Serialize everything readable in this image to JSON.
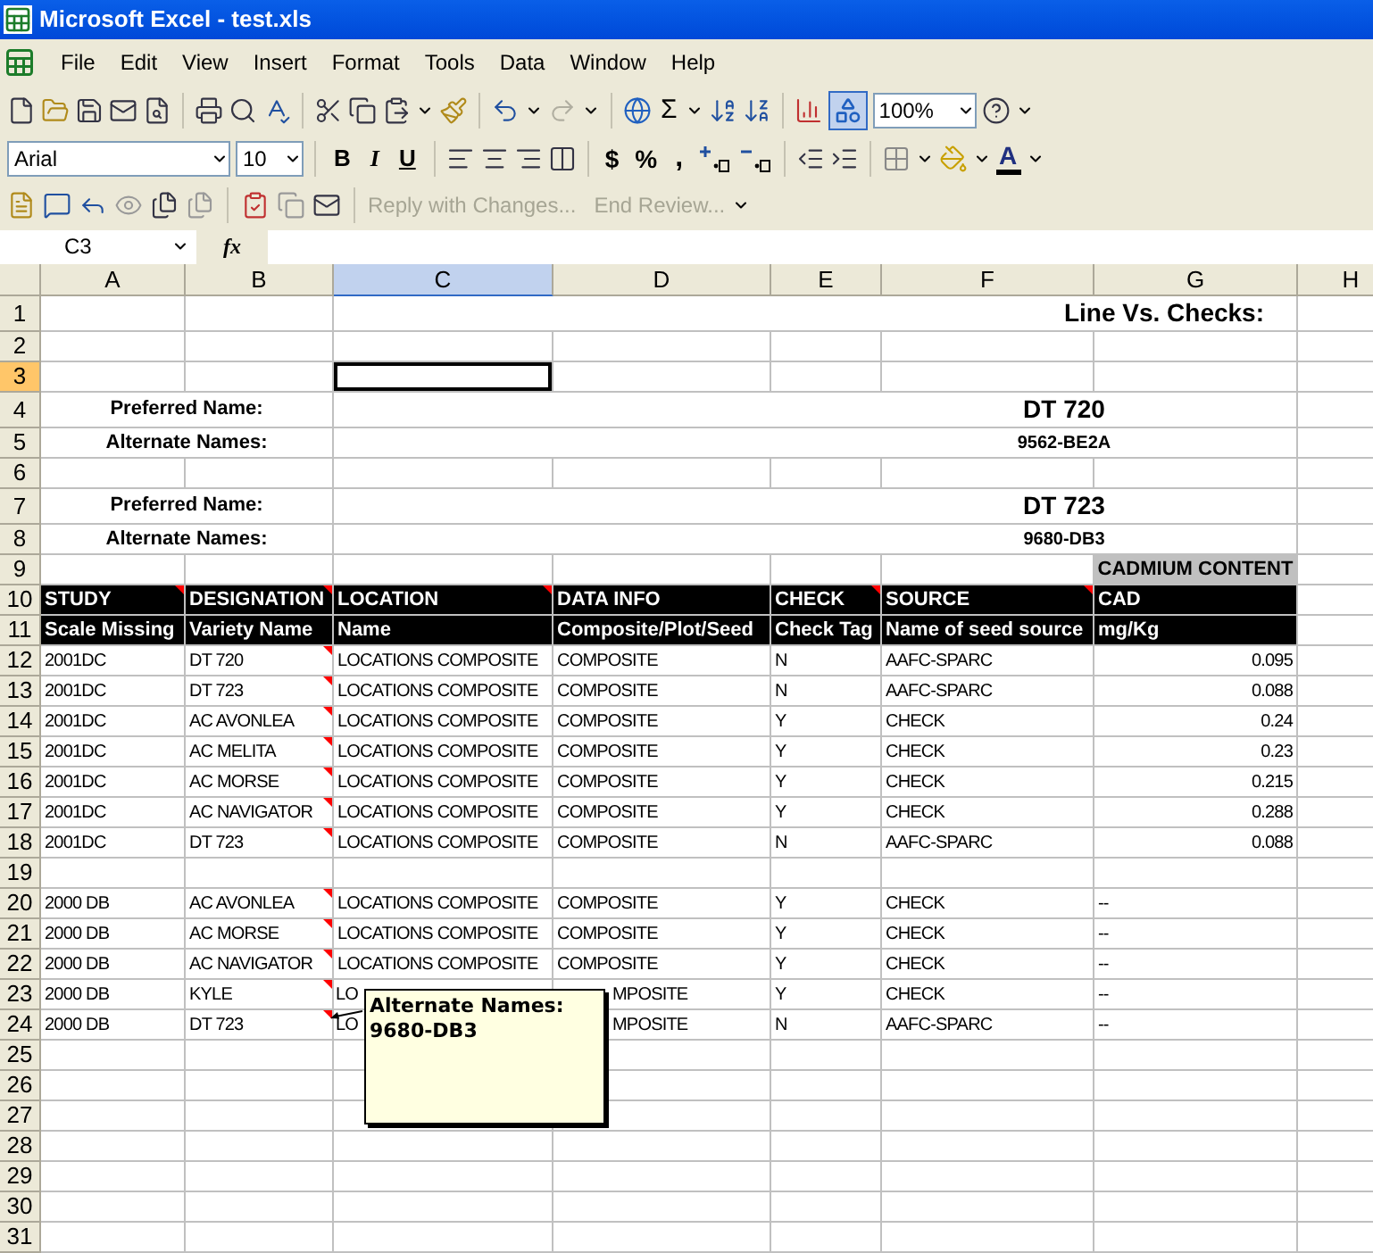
{
  "window": {
    "title": "Microsoft Excel - test.xls"
  },
  "menu": [
    "File",
    "Edit",
    "View",
    "Insert",
    "Format",
    "Tools",
    "Data",
    "Window",
    "Help"
  ],
  "standard_toolbar": {
    "autosum": "Σ",
    "zoom": "100%",
    "drawing_selected": true,
    "redo_disabled": true
  },
  "formatting_toolbar": {
    "font": "Arial",
    "size": "10",
    "bold": "B",
    "italic": "I",
    "underline": "U",
    "currency": "$",
    "percent": "%",
    "comma": ",",
    "font_color": "A"
  },
  "reviewing_toolbar": {
    "reply": "Reply with Changes...",
    "end_review": "End Review...",
    "disabled": true
  },
  "formula_bar": {
    "name_box": "C3",
    "fx": "fx"
  },
  "columns": [
    {
      "label": "A",
      "selected": false
    },
    {
      "label": "B",
      "selected": false
    },
    {
      "label": "C",
      "selected": true
    },
    {
      "label": "D",
      "selected": false
    },
    {
      "label": "E",
      "selected": false
    },
    {
      "label": "F",
      "selected": false
    },
    {
      "label": "G",
      "selected": false
    },
    {
      "label": "H",
      "selected": false
    }
  ],
  "rows": [
    {
      "number": "1",
      "selected": false,
      "kind": "title",
      "text": "Line Vs. Checks:"
    },
    {
      "number": "2",
      "selected": false,
      "kind": "blank"
    },
    {
      "number": "3",
      "selected": true,
      "kind": "blank"
    },
    {
      "number": "4",
      "selected": false,
      "kind": "preferred",
      "label": "Preferred Name:",
      "value": "DT 720"
    },
    {
      "number": "5",
      "selected": false,
      "kind": "alternate",
      "label": "Alternate Names:",
      "value": "9562-BE2A"
    },
    {
      "number": "6",
      "selected": false,
      "kind": "blank"
    },
    {
      "number": "7",
      "selected": false,
      "kind": "preferred",
      "label": "Preferred Name:",
      "value": "DT 723"
    },
    {
      "number": "8",
      "selected": false,
      "kind": "alternate",
      "label": "Alternate Names:",
      "value": "9680-DB3"
    },
    {
      "number": "9",
      "selected": false,
      "kind": "band",
      "text": "CADMIUM CONTENT"
    },
    {
      "number": "10",
      "selected": false,
      "kind": "header",
      "cells": [
        {
          "text": "STUDY",
          "comment": true
        },
        {
          "text": "DESIGNATION",
          "comment": true
        },
        {
          "text": "LOCATION",
          "comment": true
        },
        {
          "text": "DATA INFO",
          "comment": false
        },
        {
          "text": "CHECK",
          "comment": true
        },
        {
          "text": "SOURCE",
          "comment": true
        },
        {
          "text": "CAD",
          "comment": false
        }
      ]
    },
    {
      "number": "11",
      "selected": false,
      "kind": "header",
      "cells": [
        {
          "text": "Scale Missing",
          "comment": false
        },
        {
          "text": "Variety Name",
          "comment": false
        },
        {
          "text": "Name",
          "comment": false
        },
        {
          "text": "Composite/Plot/Seed",
          "comment": false
        },
        {
          "text": "Check Tag",
          "comment": false
        },
        {
          "text": "Name of seed source",
          "comment": false
        },
        {
          "text": "mg/Kg",
          "comment": false
        }
      ]
    },
    {
      "number": "12",
      "selected": false,
      "kind": "data",
      "comment": true,
      "numeric": true,
      "covered": false,
      "cells": [
        "2001DC",
        "DT 720",
        "LOCATIONS COMPOSITE",
        "COMPOSITE",
        "N",
        "AAFC-SPARC",
        "0.095"
      ]
    },
    {
      "number": "13",
      "selected": false,
      "kind": "data",
      "comment": true,
      "numeric": true,
      "covered": false,
      "cells": [
        "2001DC",
        "DT 723",
        "LOCATIONS COMPOSITE",
        "COMPOSITE",
        "N",
        "AAFC-SPARC",
        "0.088"
      ]
    },
    {
      "number": "14",
      "selected": false,
      "kind": "data",
      "comment": true,
      "numeric": true,
      "covered": false,
      "cells": [
        "2001DC",
        "AC AVONLEA",
        "LOCATIONS COMPOSITE",
        "COMPOSITE",
        "Y",
        "CHECK",
        "0.24"
      ]
    },
    {
      "number": "15",
      "selected": false,
      "kind": "data",
      "comment": true,
      "numeric": true,
      "covered": false,
      "cells": [
        "2001DC",
        "AC MELITA",
        "LOCATIONS COMPOSITE",
        "COMPOSITE",
        "Y",
        "CHECK",
        "0.23"
      ]
    },
    {
      "number": "16",
      "selected": false,
      "kind": "data",
      "comment": true,
      "numeric": true,
      "covered": false,
      "cells": [
        "2001DC",
        "AC MORSE",
        "LOCATIONS COMPOSITE",
        "COMPOSITE",
        "Y",
        "CHECK",
        "0.215"
      ]
    },
    {
      "number": "17",
      "selected": false,
      "kind": "data",
      "comment": true,
      "numeric": true,
      "covered": false,
      "cells": [
        "2001DC",
        "AC NAVIGATOR",
        "LOCATIONS COMPOSITE",
        "COMPOSITE",
        "Y",
        "CHECK",
        "0.288"
      ]
    },
    {
      "number": "18",
      "selected": false,
      "kind": "data",
      "comment": true,
      "numeric": true,
      "covered": false,
      "cells": [
        "2001DC",
        "DT 723",
        "LOCATIONS COMPOSITE",
        "COMPOSITE",
        "N",
        "AAFC-SPARC",
        "0.088"
      ]
    },
    {
      "number": "19",
      "selected": false,
      "kind": "blank"
    },
    {
      "number": "20",
      "selected": false,
      "kind": "data",
      "comment": true,
      "numeric": false,
      "covered": false,
      "cells": [
        "2000 DB",
        "AC AVONLEA",
        "LOCATIONS COMPOSITE",
        "COMPOSITE",
        "Y",
        "CHECK",
        "--"
      ]
    },
    {
      "number": "21",
      "selected": false,
      "kind": "data",
      "comment": true,
      "numeric": false,
      "covered": false,
      "cells": [
        "2000 DB",
        "AC MORSE",
        "LOCATIONS COMPOSITE",
        "COMPOSITE",
        "Y",
        "CHECK",
        "--"
      ]
    },
    {
      "number": "22",
      "selected": false,
      "kind": "data",
      "comment": true,
      "numeric": false,
      "covered": false,
      "cells": [
        "2000 DB",
        "AC NAVIGATOR",
        "LOCATIONS COMPOSITE",
        "COMPOSITE",
        "Y",
        "CHECK",
        "--"
      ]
    },
    {
      "number": "23",
      "selected": false,
      "kind": "data",
      "comment": true,
      "numeric": false,
      "covered": true,
      "cells": [
        "2000 DB",
        "KYLE",
        "LO",
        "MPOSITE",
        "Y",
        "CHECK",
        "--"
      ]
    },
    {
      "number": "24",
      "selected": false,
      "kind": "data",
      "comment": true,
      "numeric": false,
      "covered": true,
      "cells": [
        "2000 DB",
        "DT 723",
        "LO",
        "MPOSITE",
        "N",
        "AAFC-SPARC",
        "--"
      ]
    },
    {
      "number": "25",
      "selected": false,
      "kind": "blank"
    },
    {
      "number": "26",
      "selected": false,
      "kind": "blank"
    },
    {
      "number": "27",
      "selected": false,
      "kind": "blank"
    },
    {
      "number": "28",
      "selected": false,
      "kind": "blank"
    },
    {
      "number": "29",
      "selected": false,
      "kind": "blank"
    },
    {
      "number": "30",
      "selected": false,
      "kind": "blank"
    },
    {
      "number": "31",
      "selected": false,
      "kind": "blank"
    }
  ],
  "comment": {
    "title": "Alternate Names:",
    "text": "9680-DB3"
  }
}
